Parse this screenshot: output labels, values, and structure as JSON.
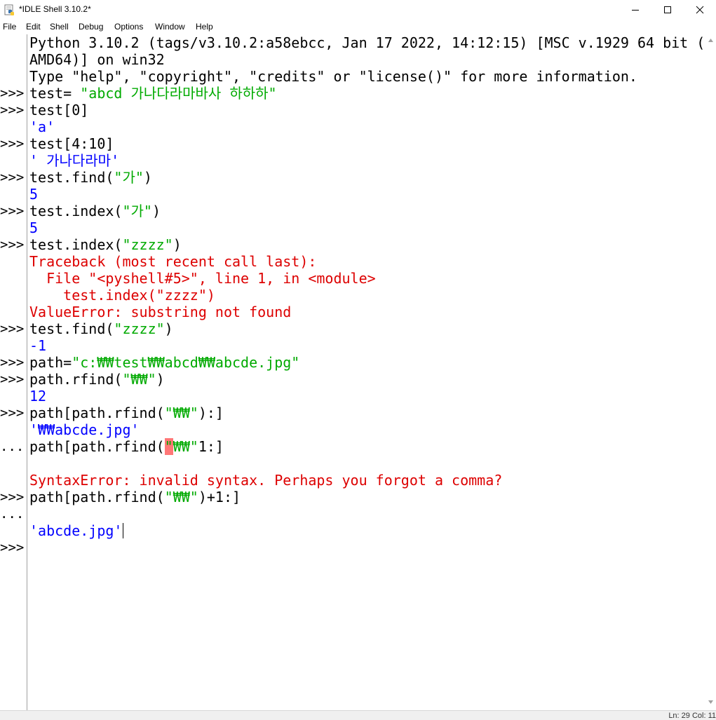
{
  "window": {
    "title": "*IDLE Shell 3.10.2*",
    "buttons": [
      "minimize",
      "maximize",
      "close"
    ]
  },
  "menu": [
    "File",
    "Edit",
    "Shell",
    "Debug",
    "Options",
    "Window",
    "Help"
  ],
  "colors": {
    "stdout": "#0000ff",
    "stderr": "#dd0000",
    "string": "#00aa00",
    "prompt": "#000000",
    "error_highlight": "#ff7777"
  },
  "shell": {
    "prompts": [
      ">>>",
      ">>>",
      ">>>",
      ">>>",
      ">>>",
      ">>>",
      ">>>",
      ">>>",
      ">>>",
      ">>>",
      "...",
      ">>>",
      "...",
      ">>>"
    ],
    "lines": [
      [
        {
          "t": "Python 3.10.2 (tags/v3.10.2:a58ebcc, Jan 17 2022, 14:12:15) [MSC v.1929 64 bit (",
          "c": "black"
        }
      ],
      [
        {
          "t": "AMD64)] on win32",
          "c": "black"
        }
      ],
      [
        {
          "t": "Type \"help\", \"copyright\", \"credits\" or \"license()\" for more information.",
          "c": "black"
        }
      ],
      [
        {
          "t": "test= ",
          "c": "black"
        },
        {
          "t": "\"abcd 가나다라마바사 하하하\"",
          "c": "green"
        }
      ],
      [
        {
          "t": "test[0]",
          "c": "black"
        }
      ],
      [
        {
          "t": "'a'",
          "c": "blue"
        }
      ],
      [
        {
          "t": "test[4:10]",
          "c": "black"
        }
      ],
      [
        {
          "t": "' 가나다라마'",
          "c": "blue"
        }
      ],
      [
        {
          "t": "test.find(",
          "c": "black"
        },
        {
          "t": "\"가\"",
          "c": "green"
        },
        {
          "t": ")",
          "c": "black"
        }
      ],
      [
        {
          "t": "5",
          "c": "blue"
        }
      ],
      [
        {
          "t": "test.index(",
          "c": "black"
        },
        {
          "t": "\"가\"",
          "c": "green"
        },
        {
          "t": ")",
          "c": "black"
        }
      ],
      [
        {
          "t": "5",
          "c": "blue"
        }
      ],
      [
        {
          "t": "test.index(",
          "c": "black"
        },
        {
          "t": "\"zzzz\"",
          "c": "green"
        },
        {
          "t": ")",
          "c": "black"
        }
      ],
      [
        {
          "t": "Traceback (most recent call last):",
          "c": "red"
        }
      ],
      [
        {
          "t": "  File \"<pyshell#5>\", line 1, in <module>",
          "c": "red"
        }
      ],
      [
        {
          "t": "    test.index(\"zzzz\")",
          "c": "red"
        }
      ],
      [
        {
          "t": "ValueError: substring not found",
          "c": "red"
        }
      ],
      [
        {
          "t": "test.find(",
          "c": "black"
        },
        {
          "t": "\"zzzz\"",
          "c": "green"
        },
        {
          "t": ")",
          "c": "black"
        }
      ],
      [
        {
          "t": "-1",
          "c": "blue"
        }
      ],
      [
        {
          "t": "path=",
          "c": "black"
        },
        {
          "t": "\"c:₩₩test₩₩abcd₩₩abcde.jpg\"",
          "c": "green"
        }
      ],
      [
        {
          "t": "path.rfind(",
          "c": "black"
        },
        {
          "t": "\"₩₩\"",
          "c": "green"
        },
        {
          "t": ")",
          "c": "black"
        }
      ],
      [
        {
          "t": "12",
          "c": "blue"
        }
      ],
      [
        {
          "t": "path[path.rfind(",
          "c": "black"
        },
        {
          "t": "\"₩₩\"",
          "c": "green"
        },
        {
          "t": "):]",
          "c": "black"
        }
      ],
      [
        {
          "t": "'₩₩abcde.jpg'",
          "c": "blue"
        }
      ],
      [
        {
          "t": "path[path.rfind(",
          "c": "black"
        },
        {
          "t": "\"",
          "c": "green",
          "hl": true
        },
        {
          "t": "₩₩\"",
          "c": "green"
        },
        {
          "t": "1:]",
          "c": "black"
        }
      ],
      [
        {
          "t": "",
          "c": "black"
        }
      ],
      [
        {
          "t": "SyntaxError: invalid syntax. Perhaps you forgot a comma?",
          "c": "red"
        }
      ],
      [
        {
          "t": "path[path.rfind(",
          "c": "black"
        },
        {
          "t": "\"₩₩\"",
          "c": "green"
        },
        {
          "t": ")+1:]",
          "c": "black"
        }
      ],
      [
        {
          "t": "",
          "c": "black"
        }
      ],
      [
        {
          "t": "'abcde.jpg'",
          "c": "blue",
          "caret": true
        }
      ],
      [
        {
          "t": "",
          "c": "black"
        }
      ]
    ]
  },
  "status": "Ln: 29  Col: 11"
}
